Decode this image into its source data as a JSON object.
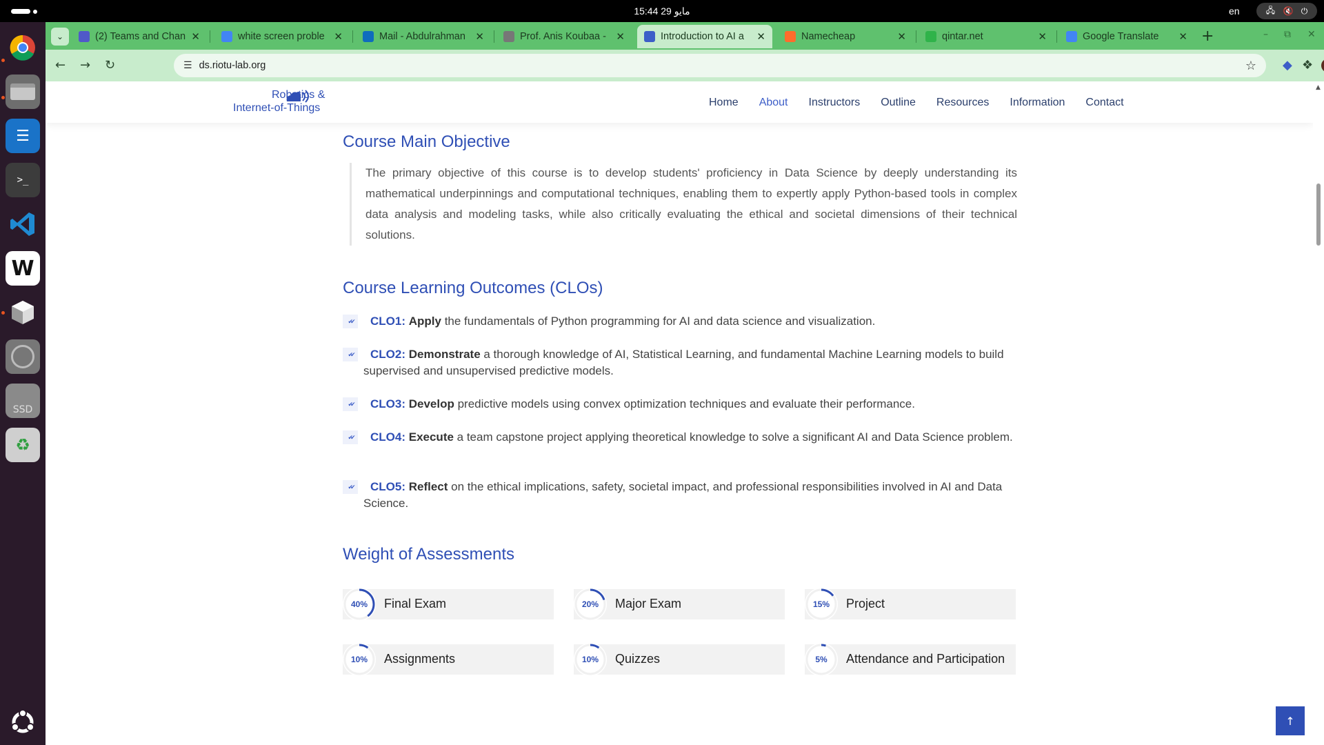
{
  "system": {
    "clock": "15:44  29 مايو",
    "lang": "en",
    "tray_icons": [
      "network-icon",
      "volume-icon",
      "power-icon"
    ]
  },
  "dock": {
    "items": [
      "chrome-icon",
      "files-icon",
      "writer-icon",
      "terminal-icon",
      "vscode-icon",
      "w-app-icon",
      "box-app-icon",
      "disc-icon",
      "ssd-icon",
      "trash-icon"
    ],
    "ssd_label": "SSD",
    "apps_grid": "show-apps-icon"
  },
  "browser": {
    "tabs": [
      {
        "title": "(2) Teams and Chan",
        "color": "#5059c9"
      },
      {
        "title": "white screen proble",
        "color": "#4285f4"
      },
      {
        "title": "Mail - Abdulrahman",
        "color": "#0f6cbd"
      },
      {
        "title": "Prof. Anis Koubaa -",
        "color": "#777777"
      },
      {
        "title": "Introduction to AI a",
        "color": "#3d5ec8"
      },
      {
        "title": "Namecheap",
        "color": "#ff6c2c"
      },
      {
        "title": "qintar.net",
        "color": "#2fb34a"
      },
      {
        "title": "Google Translate",
        "color": "#4285f4"
      }
    ],
    "url": "ds.riotu-lab.org"
  },
  "site": {
    "logo_line1": "Robotics &",
    "logo_line2": "Internet-of-Things",
    "nav": [
      "Home",
      "About",
      "Instructors",
      "Outline",
      "Resources",
      "Information",
      "Contact"
    ],
    "active_nav": "About"
  },
  "main": {
    "objective_heading": "Course Main Objective",
    "objective_text": "The primary objective of this course is to develop students' proficiency in Data Science by deeply understanding its mathematical underpinnings and computational techniques, enabling them to expertly apply Python-based tools in complex data analysis and modeling tasks, while also critically evaluating the ethical and societal dimensions of their technical solutions.",
    "clo_heading": "Course Learning Outcomes (CLOs)",
    "clos": [
      {
        "code": "CLO1:",
        "verb": "Apply",
        "text": " the fundamentals of Python programming for AI and data science and visualization."
      },
      {
        "code": "CLO2:",
        "verb": "Demonstrate",
        "text": " a thorough knowledge of AI, Statistical Learning, and fundamental Machine Learning models to build supervised and unsupervised predictive models."
      },
      {
        "code": "CLO3:",
        "verb": "Develop",
        "text": " predictive models using convex optimization techniques and evaluate their performance."
      },
      {
        "code": "CLO4:",
        "verb": "Execute",
        "text": " a team capstone project applying theoretical knowledge to solve a significant AI and Data Science problem."
      },
      {
        "code": "CLO5:",
        "verb": "Reflect",
        "text": " on the ethical implications, safety, societal impact, and professional responsibilities involved in AI and Data Science."
      }
    ],
    "assess_heading": "Weight of Assessments",
    "assessments": [
      {
        "label": "Final Exam",
        "pct_text": "40%",
        "pct": 40
      },
      {
        "label": "Major Exam",
        "pct_text": "20%",
        "pct": 20
      },
      {
        "label": "Project",
        "pct_text": "15%",
        "pct": 15
      },
      {
        "label": "Assignments",
        "pct_text": "10%",
        "pct": 10
      },
      {
        "label": "Quizzes",
        "pct_text": "10%",
        "pct": 10
      },
      {
        "label": "Attendance and Participation",
        "pct_text": "5%",
        "pct": 5
      }
    ]
  },
  "colors": {
    "accent": "#2f4fb5",
    "tabstrip": "#5fc16e",
    "toolbar": "#c8eccc",
    "dock": "#2a1a2a"
  }
}
